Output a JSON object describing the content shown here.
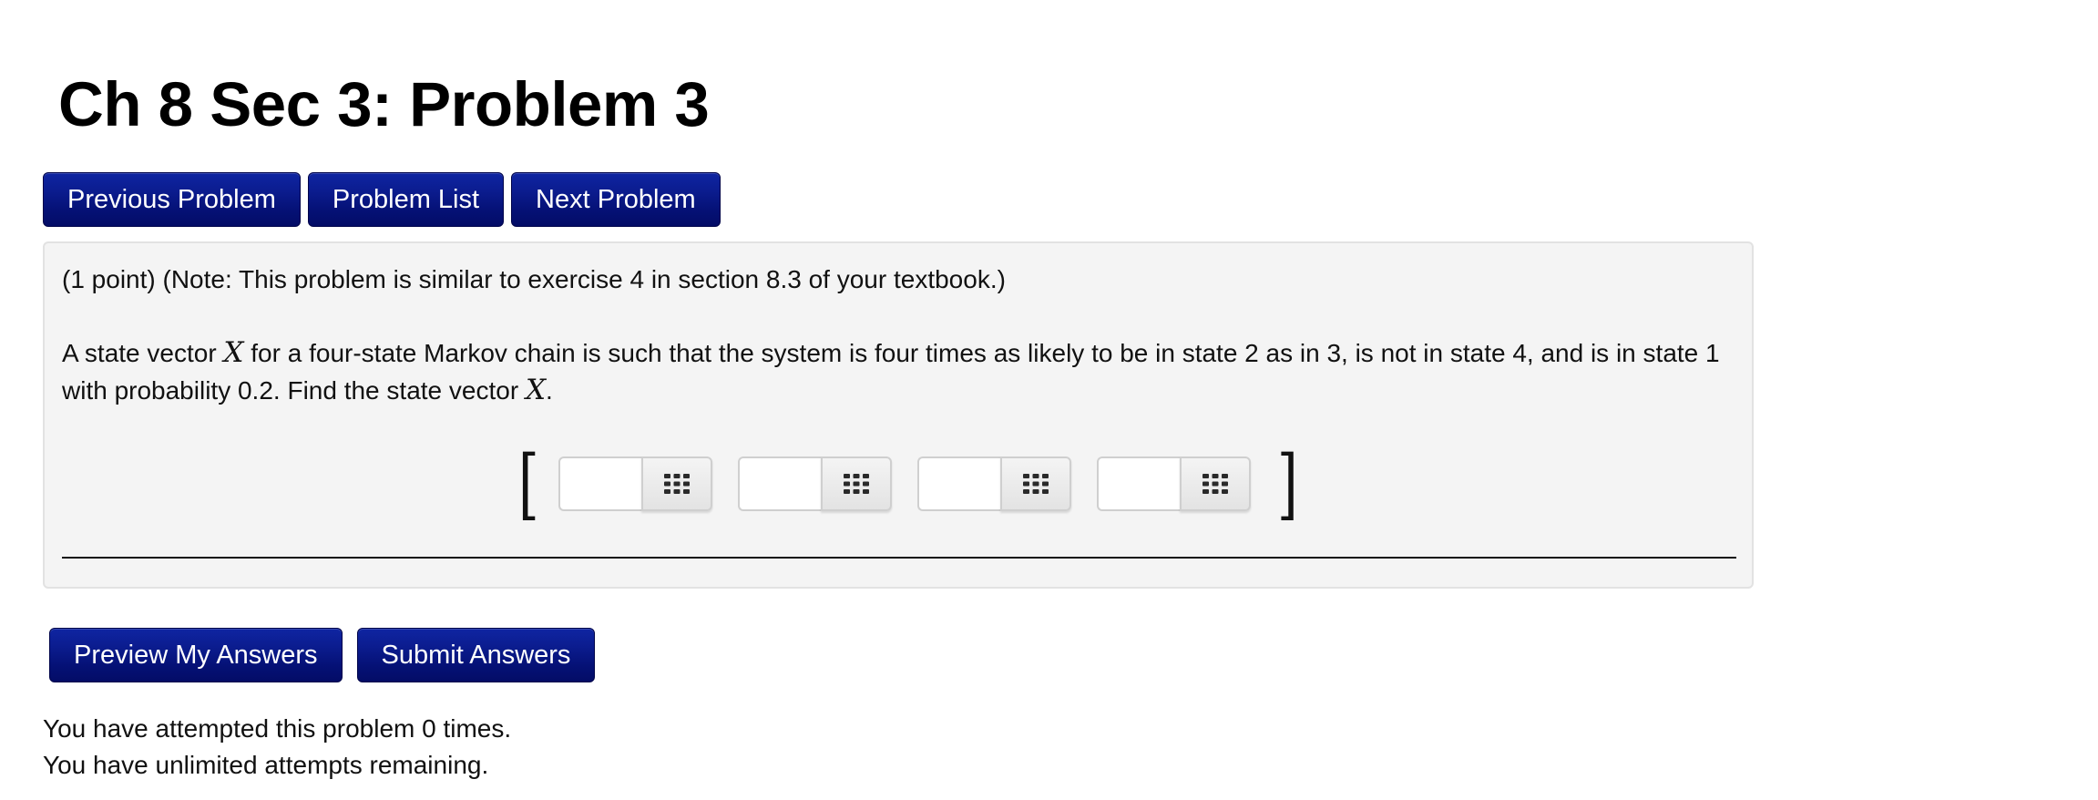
{
  "page": {
    "title": "Ch 8 Sec 3: Problem 3"
  },
  "nav": {
    "previous_label": "Previous Problem",
    "list_label": "Problem List",
    "next_label": "Next Problem"
  },
  "problem": {
    "note": "(1 point) (Note: This problem is similar to exercise 4 in section 8.3 of your textbook.)",
    "statement_part1": "A state vector",
    "statement_var1": "X",
    "statement_part2": "for a four-state Markov chain is such that the system is four times as likely to be in state 2 as in 3, is not in state 4, and is in state 1 with probability 0.2. Find the state vector",
    "statement_var2": "X",
    "statement_end": ".",
    "left_bracket": "[",
    "right_bracket": "]",
    "answers": [
      {
        "value": "",
        "keypad_icon": "keypad-grid-icon"
      },
      {
        "value": "",
        "keypad_icon": "keypad-grid-icon"
      },
      {
        "value": "",
        "keypad_icon": "keypad-grid-icon"
      },
      {
        "value": "",
        "keypad_icon": "keypad-grid-icon"
      }
    ]
  },
  "actions": {
    "preview_label": "Preview My Answers",
    "submit_label": "Submit Answers"
  },
  "status": {
    "attempts": "You have attempted this problem 0 times.",
    "remaining": "You have unlimited attempts remaining."
  },
  "colors": {
    "button_primary": "#0b1c8e",
    "button_text": "#ffffff",
    "problem_bg": "#f4f4f4"
  }
}
